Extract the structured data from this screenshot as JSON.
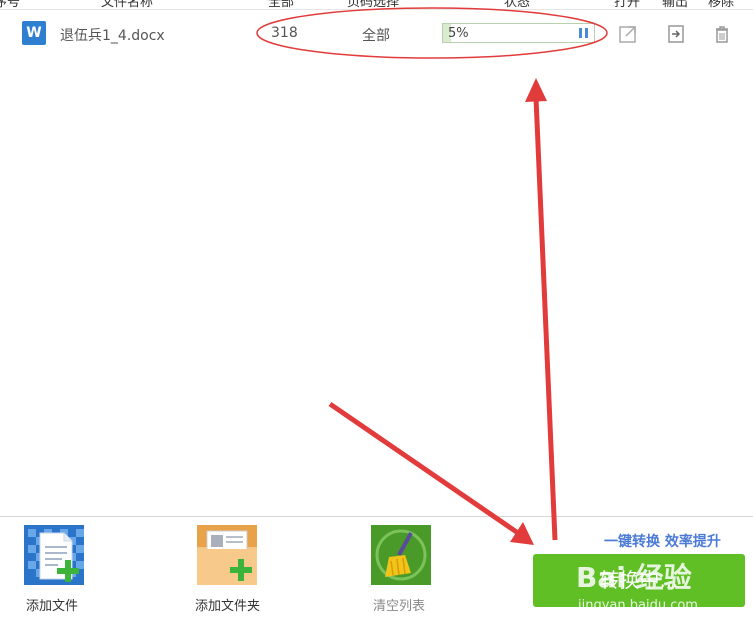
{
  "header": {
    "columns": [
      "序号",
      "文件名称",
      "全部",
      "页码选择",
      "状态",
      "打开",
      "输出",
      "移除"
    ]
  },
  "file_row": {
    "icon_letter": "W",
    "name": "退伍兵1_4.docx",
    "pages": "318",
    "page_range": "全部",
    "progress_text": "5%",
    "progress_fraction": 0.05
  },
  "toolbar": {
    "add_file": "添加文件",
    "add_folder": "添加文件夹",
    "clear_list": "清空列表",
    "slogan": "一键转换  效率提升",
    "convert": "转换中..."
  },
  "watermark": {
    "brand": "Bai 经验",
    "url": "jingyan.baidu.com"
  },
  "colors": {
    "accent_green": "#5fbf25",
    "slogan_blue": "#4b7bd6",
    "annotation_red": "#e23b3b"
  }
}
